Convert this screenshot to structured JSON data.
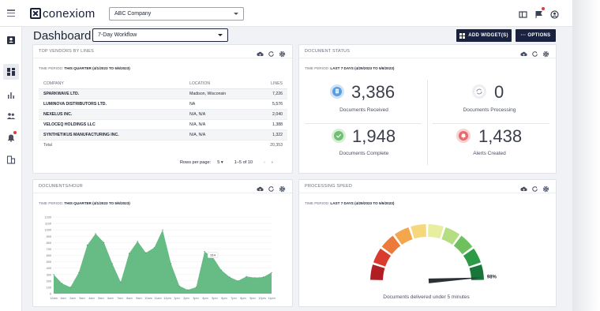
{
  "topbar": {
    "logo_text": "conexiom",
    "company_select": "ABC Company",
    "icons": [
      "menu-icon",
      "panel-icon",
      "flag-icon",
      "user-icon"
    ]
  },
  "rail": {
    "icons": [
      "contacts-icon",
      "dashboard-icon",
      "analytics-icon",
      "users-icon",
      "notifications-icon",
      "buildings-icon"
    ]
  },
  "header": {
    "title": "Dashboard",
    "workflow_select": "7-Day Workflow",
    "add_widget_label": "ADD WIDGET(S)",
    "options_label": "··· OPTIONS"
  },
  "vendors": {
    "title": "TOP VENDORS BY LINES",
    "period_label": "TIME PERIOD:",
    "period_value": "THIS QUARTER (4/1/2023 TO 5/6/2023)",
    "columns": [
      "COMPANY",
      "LOCATION",
      "LINES"
    ],
    "rows": [
      {
        "company": "SPARKWAVE LTD.",
        "location": "Madison, Wisconsin",
        "lines": "7,226"
      },
      {
        "company": "LUMINOVA DISTRIBUTORS LTD.",
        "location": "NA",
        "lines": "5,576"
      },
      {
        "company": "NEXELUS INC.",
        "location": "N/A, N/A",
        "lines": "2,040"
      },
      {
        "company": "VELOCEQ HOLDINGS LLC",
        "location": "N/A, N/A",
        "lines": "1,388"
      },
      {
        "company": "SYNTHETIKUS MANUFACTURING INC.",
        "location": "N/A, N/A",
        "lines": "1,322"
      }
    ],
    "total_label": "Total",
    "total_value": "20,353",
    "rows_per_page_label": "Rows per page:",
    "rows_per_page": "5",
    "page_range": "1–5 of 10"
  },
  "status": {
    "title": "DOCUMENT STATUS",
    "period_label": "TIME PERIOD:",
    "period_value": "LAST 7 DAYS (4/29/2023 TO 5/6/2023)",
    "items": [
      {
        "value": "3,386",
        "label": "Documents Received",
        "color": "#5a9ee0",
        "icon": "document-icon"
      },
      {
        "value": "0",
        "label": "Documents Processing",
        "color": "#b8bcc4",
        "icon": "sync-icon"
      },
      {
        "value": "1,948",
        "label": "Documents Complete",
        "color": "#6fbf73",
        "icon": "check-icon"
      },
      {
        "value": "1,438",
        "label": "Alerts Created",
        "color": "#e86a6a",
        "icon": "bell-icon"
      }
    ]
  },
  "docs_per_hour": {
    "title": "DOCUMENTS/HOUR",
    "period_label": "TIME PERIOD:",
    "period_value": "THIS QUARTER (4/1/2023 TO 5/6/2023)",
    "tooltip": "314",
    "color": "#4caf6e"
  },
  "speed": {
    "title": "PROCESSING SPEED",
    "period_label": "TIME PERIOD:",
    "period_value": "LAST 7 DAYS (4/29/2023 TO 5/6/2023)",
    "value_label": "98%",
    "value": 0.98,
    "caption": "Documents delivered under 5 minutes",
    "segment_colors": [
      "#b01e24",
      "#d93b2f",
      "#ec7a3a",
      "#f3a64b",
      "#f6d77c",
      "#e8eea0",
      "#b5dd82",
      "#6fc15d",
      "#2d9a45",
      "#19763a"
    ]
  },
  "chart_data": {
    "type": "area",
    "x": [
      "12am",
      "1am",
      "2am",
      "3am",
      "4am",
      "5am",
      "6am",
      "7am",
      "8am",
      "9am",
      "10am",
      "11am",
      "12pm",
      "1pm",
      "2pm",
      "3pm",
      "4pm",
      "5pm",
      "6pm",
      "7pm",
      "8pm",
      "9pm",
      "10pm",
      "11pm"
    ],
    "yticks": [
      "1200",
      "1100",
      "1000",
      "900",
      "800",
      "700",
      "600",
      "500",
      "400",
      "300",
      "200",
      "100",
      "0"
    ],
    "ylim": [
      0,
      1200
    ],
    "series": [
      {
        "values": [
          300,
          160,
          100,
          330,
          760,
          940,
          800,
          470,
          180,
          630,
          820,
          640,
          720,
          1000,
          470,
          120,
          60,
          100,
          660,
          570,
          370,
          260,
          200,
          270,
          250,
          260,
          330
        ]
      }
    ],
    "grid": true
  }
}
